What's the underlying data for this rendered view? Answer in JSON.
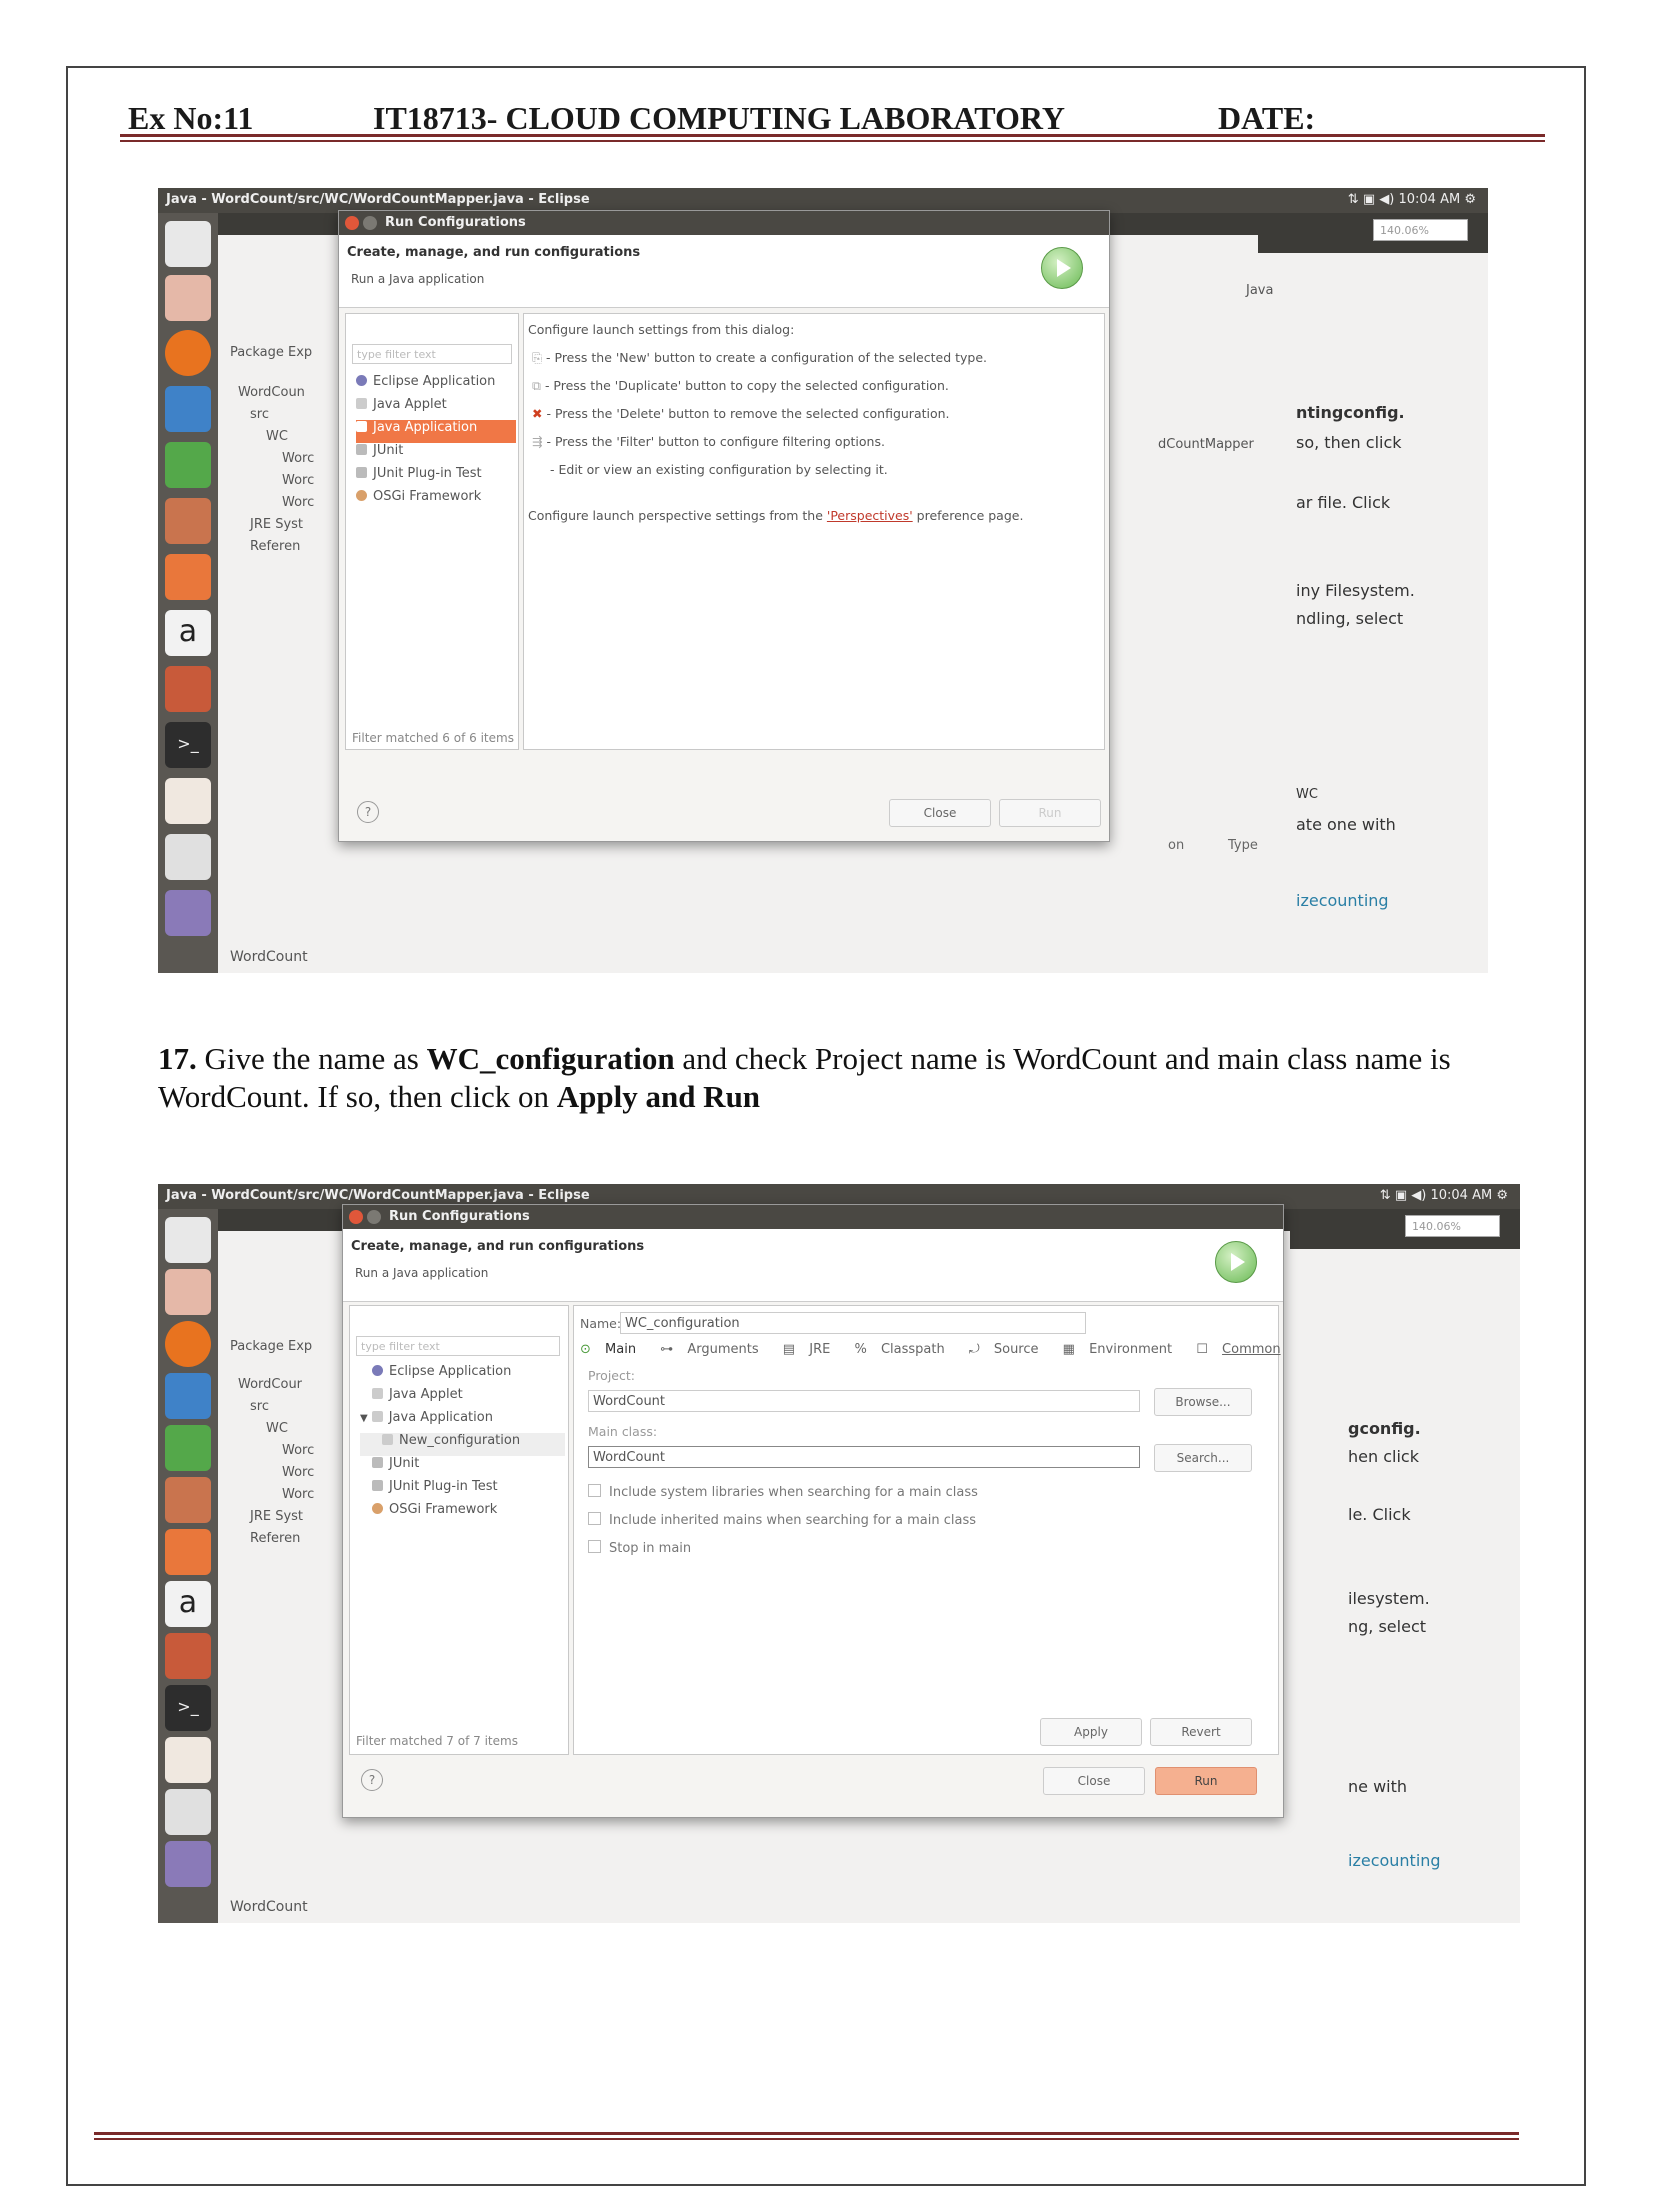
{
  "header": {
    "ex": "Ex No:11",
    "course": "IT18713- CLOUD COMPUTING LABORATORY",
    "date": "DATE:"
  },
  "shot1": {
    "window_title": "Java - WordCount/src/WC/WordCountMapper.java - Eclipse",
    "clock": "10:04 AM",
    "zoom": "140.06%",
    "dialog_title": "Run Configurations",
    "heading": "Create, manage, and run configurations",
    "subheading": "Run a Java application",
    "filter_placeholder": "type filter text",
    "config_types": [
      "Eclipse Application",
      "Java Applet",
      "Java Application",
      "JUnit",
      "JUnit Plug-in Test",
      "OSGi Framework"
    ],
    "filter_status": "Filter matched 6 of 6 items",
    "info_lines": [
      "Configure launch settings from this dialog:",
      "- Press the 'New' button to create a configuration of the selected type.",
      "- Press the 'Duplicate' button to copy the selected configuration.",
      "- Press the 'Delete' button to remove the selected configuration.",
      "- Press the 'Filter' button to configure filtering options.",
      "- Edit or view an existing configuration by selecting it."
    ],
    "perspective_pre": "Configure launch perspective settings from the ",
    "perspective_link": "'Perspectives'",
    "perspective_post": " preference page.",
    "close_label": "Close",
    "run_label": "Run",
    "package_explorer": "Package Exp",
    "tree": [
      "WordCoun",
      "src",
      "WC",
      "Worc",
      "Worc",
      "Worc",
      "JRE Syst",
      "Referen"
    ],
    "bg_right": [
      "ntingconfig.",
      "so, then click",
      "ar file. Click",
      "iny Filesystem.",
      "ndling, select",
      "WC",
      "ate one with",
      "izecounting"
    ],
    "bg_mapper": "dCountMapper",
    "bg_java": "Java",
    "bg_type": "Type",
    "bg_on": "on",
    "status": "WordCount"
  },
  "caption": {
    "num": "17.",
    "t1": " Give the name as ",
    "b1": "WC_configuration",
    "t2": " and check Project name is WordCount and main class name is WordCount. If so, then click on ",
    "b2": "Apply and Run"
  },
  "shot2": {
    "window_title": "Java - WordCount/src/WC/WordCountMapper.java - Eclipse",
    "clock": "10:04 AM",
    "zoom": "140.06%",
    "dialog_title": "Run Configurations",
    "heading": "Create, manage, and run configurations",
    "subheading": "Run a Java application",
    "filter_placeholder": "type filter text",
    "config_types": [
      "Eclipse Application",
      "Java Applet",
      "Java Application",
      "New_configuration",
      "JUnit",
      "JUnit Plug-in Test",
      "OSGi Framework"
    ],
    "filter_status": "Filter matched 7 of 7 items",
    "name_label": "Name:",
    "name_value": "WC_configuration",
    "tabs": [
      "Main",
      "Arguments",
      "JRE",
      "Classpath",
      "Source",
      "Environment",
      "Common"
    ],
    "project_label": "Project:",
    "project_value": "WordCount",
    "browse_label": "Browse...",
    "main_class_label": "Main class:",
    "main_class_value": "WordCount",
    "search_label": "Search...",
    "checks": [
      "Include system libraries when searching for a main class",
      "Include inherited mains when searching for a main class",
      "Stop in main"
    ],
    "apply_label": "Apply",
    "revert_label": "Revert",
    "close_label": "Close",
    "run_label": "Run",
    "package_explorer": "Package Exp",
    "tree": [
      "WordCour",
      "src",
      "WC",
      "Worc",
      "Worc",
      "Worc",
      "JRE Syst",
      "Referen"
    ],
    "bg_right": [
      "gconfig.",
      "hen click",
      "le. Click",
      "ilesystem.",
      "ng, select",
      "ne with",
      "izecounting"
    ],
    "status": "WordCount"
  }
}
